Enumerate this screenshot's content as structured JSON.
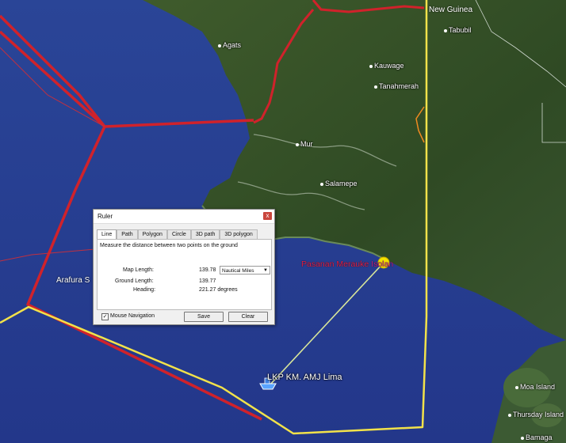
{
  "map": {
    "places": [
      {
        "name": "Agats"
      },
      {
        "name": "Kauwage"
      },
      {
        "name": "Tanahmerah"
      },
      {
        "name": "Mur"
      },
      {
        "name": "Salamepe"
      },
      {
        "name": "Tabubil"
      },
      {
        "name": "Moa Island"
      },
      {
        "name": "Thursday Island"
      },
      {
        "name": "Bamaga"
      }
    ],
    "region_label": "New Guinea",
    "sea_label": "Arafura S",
    "pin_label": "Pasanan Merauke",
    "pin_label_tail": "Isolan",
    "ship_label": "LKP KM. AMJ Lima",
    "colors": {
      "sea": "#2f4a9a",
      "land": "#3e5a2e",
      "border_red": "#d0222b",
      "border_yellow": "#f2e24a",
      "measure_line": "#d9e79a"
    }
  },
  "ruler": {
    "title": "Ruler",
    "close": "x",
    "tabs": [
      "Line",
      "Path",
      "Polygon",
      "Circle",
      "3D path",
      "3D polygon"
    ],
    "description": "Measure the distance between two points on the ground",
    "map_length_label": "Map Length:",
    "map_length_value": "139.78",
    "unit": "Nautical Miles",
    "ground_length_label": "Ground Length:",
    "ground_length_value": "139.77",
    "heading_label": "Heading:",
    "heading_value": "221.27 degrees",
    "mouse_nav_label": "Mouse Navigation",
    "mouse_nav_checked": "✓",
    "save_label": "Save",
    "clear_label": "Clear"
  }
}
